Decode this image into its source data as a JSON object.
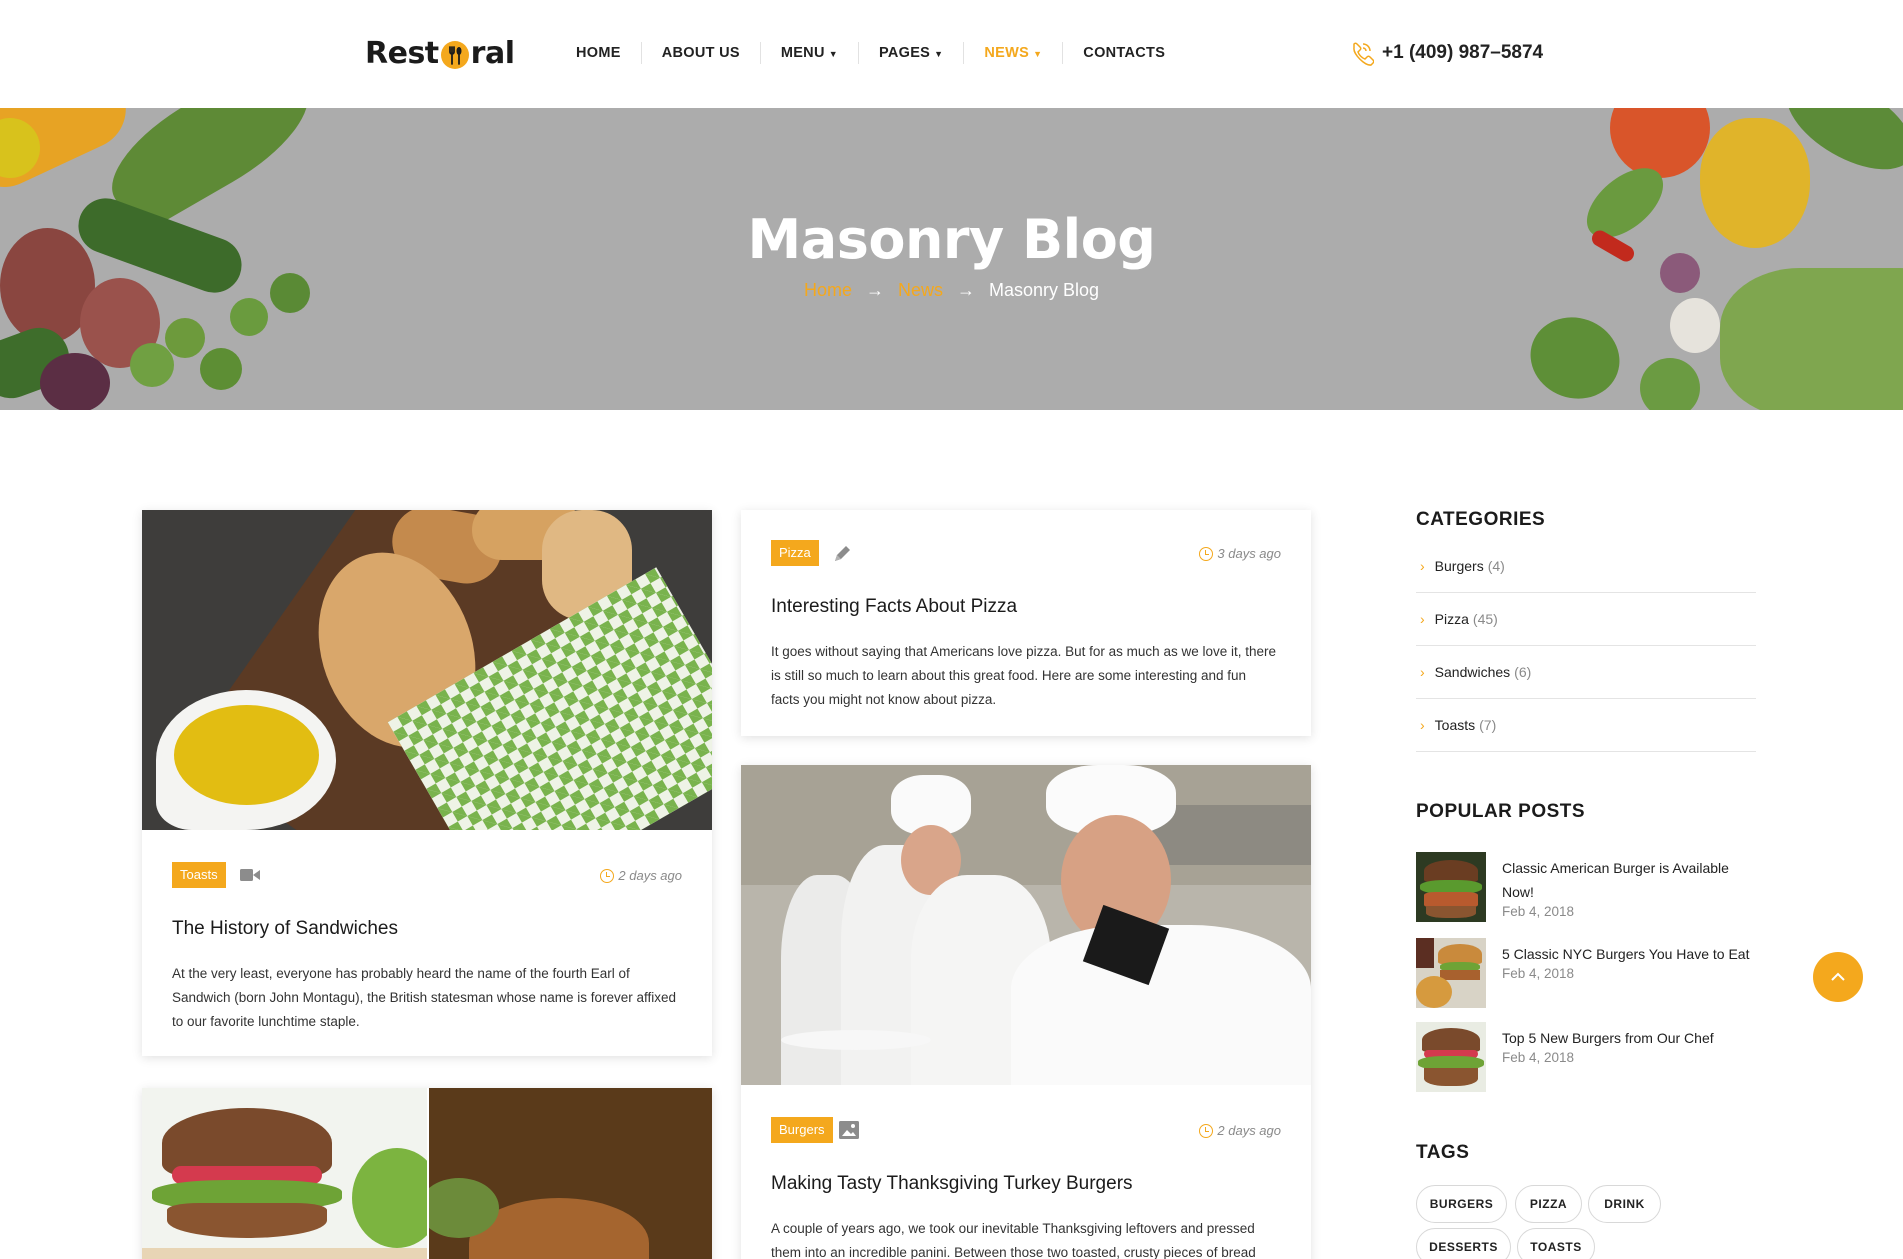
{
  "header": {
    "logo_pre": "Rest",
    "logo_post": "ral",
    "nav": [
      {
        "label": "HOME",
        "caret": ""
      },
      {
        "label": "ABOUT US",
        "caret": ""
      },
      {
        "label": "MENU",
        "caret": "⌄"
      },
      {
        "label": "PAGES",
        "caret": "⌄"
      },
      {
        "label": "NEWS",
        "caret": "⌄",
        "active": true
      },
      {
        "label": "CONTACTS",
        "caret": ""
      }
    ],
    "phone": "+1 (409) 987–5874",
    "phone_icon": "phone-icon",
    "accent": "#f4a81d"
  },
  "hero": {
    "title": "Masonry Blog",
    "crumbs": [
      "Home",
      "News",
      "Masonry Blog"
    ],
    "arrow": "→"
  },
  "posts": [
    {
      "category": "Toasts",
      "media": "video-icon",
      "date": "2 days ago",
      "title": "The History of Sandwiches",
      "text_lines": [
        "At the very least, everyone has probably heard the name of the fourth Earl of",
        "Sandwich (born John Montagu), the British statesman whose name is forever affixed",
        "to our favorite lunchtime staple."
      ]
    },
    {
      "category": "Pizza",
      "media": "pencil-icon",
      "date": "3 days ago",
      "title": "Interesting Facts About Pizza",
      "text_lines": [
        "It goes without saying that Americans love pizza. But for as much as we love it, there",
        "is still so much to learn about this great food. Here are some interesting and fun",
        "facts you might not know about pizza."
      ]
    },
    {
      "category": "Burgers",
      "media": "image-icon",
      "date": "2 days ago",
      "title": "Making Tasty Thanksgiving Turkey Burgers",
      "text_lines": [
        "A couple of years ago, we took our inevitable Thanksgiving leftovers and pressed",
        "them into an incredible panini. Between those two toasted, crusty pieces of bread"
      ]
    }
  ],
  "sidebar": {
    "categories_title": "CATEGORIES",
    "categories": [
      {
        "name": "Burgers",
        "count": "(4)"
      },
      {
        "name": "Pizza",
        "count": "(45)"
      },
      {
        "name": "Sandwiches",
        "count": "(6)"
      },
      {
        "name": "Toasts",
        "count": "(7)"
      }
    ],
    "popular_title": "POPULAR POSTS",
    "popular": [
      {
        "title": "Classic American Burger is Available Now!",
        "date": "Feb 4, 2018"
      },
      {
        "title": "5 Classic NYC Burgers You Have to Eat",
        "date": "Feb 4, 2018"
      },
      {
        "title": "Top 5 New Burgers from Our Chef",
        "date": "Feb 4, 2018"
      }
    ],
    "tags_title": "TAGS",
    "tags": [
      "BURGERS",
      "PIZZA",
      "DRINK",
      "DESSERTS",
      "TOASTS"
    ]
  },
  "back_to_top_icon": "chevron-up-icon"
}
